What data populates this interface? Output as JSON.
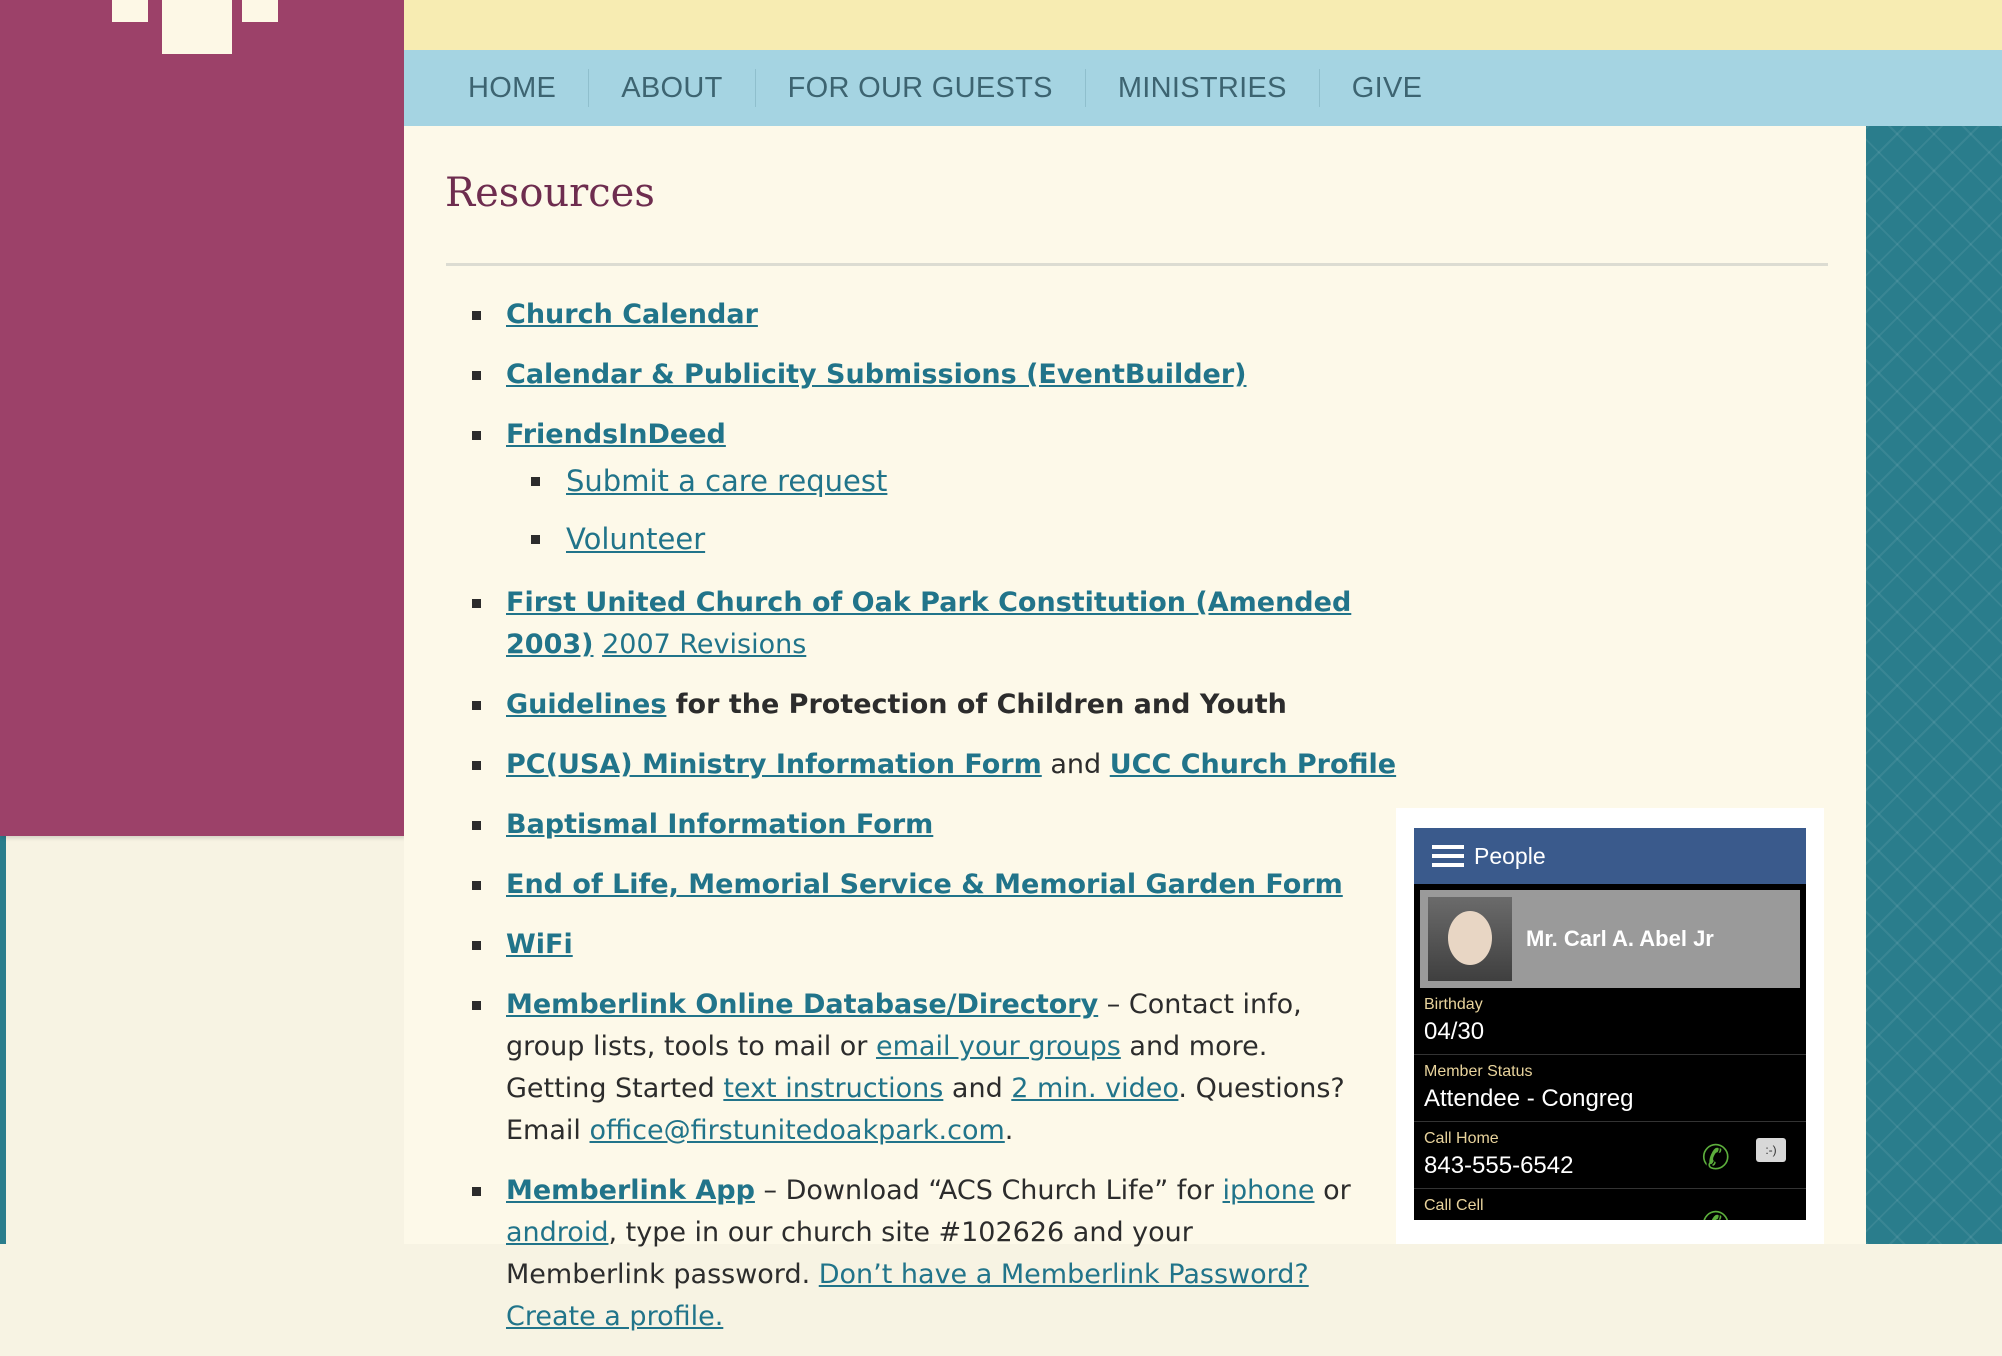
{
  "banner": {
    "tagline": ""
  },
  "nav": [
    "HOME",
    "ABOUT",
    "FOR OUR GUESTS",
    "MINISTRIES",
    "GIVE"
  ],
  "page": {
    "title": "Resources"
  },
  "links": {
    "church_calendar": "Church Calendar",
    "calendar_submissions": "Calendar & Publicity Submissions (EventBuilder)",
    "friends_in_deed": "FriendsInDeed",
    "submit_care_request": "Submit a care request",
    "volunteer": "Volunteer",
    "constitution": "First United Church of Oak Park Constitution (Amended 2003)",
    "revisions_2007": "2007 Revisions",
    "guidelines": "Guidelines",
    "guidelines_rest": " for the Protection of Children and Youth",
    "pcusa_form": "PC(USA) Ministry Information Form",
    "and": " and ",
    "ucc_profile": "UCC Church Profile",
    "baptismal_form": "Baptismal Information Form",
    "end_of_life_form": "End of Life, Memorial Service & Memorial Garden Form",
    "wifi": "WiFi",
    "memberlink_db": "Memberlink Online Database/Directory",
    "memberlink_db_text1": " – Contact info, group lists, tools to mail or ",
    "email_groups": "email your groups",
    "memberlink_db_text2": " and more. Getting Started ",
    "text_instructions": "text instructions",
    "and2": " and ",
    "two_min_video": "2 min. video",
    "memberlink_db_text3": ". Questions? Email ",
    "office_email": "office@firstunitedoakpark.com",
    "period": ".",
    "memberlink_app": "Memberlink App",
    "memberlink_app_text1": " – Download “ACS Church Life” for ",
    "iphone": "iphone",
    "or": " or ",
    "android": "android",
    "memberlink_app_text2": ", type in our church site #102626 and your Memberlink password. ",
    "create_profile": "Don’t have a Memberlink Password? Create a profile."
  },
  "phone": {
    "header": "People",
    "person_name": "Mr. Carl A. Abel Jr",
    "fields": [
      {
        "label": "Birthday",
        "value": "04/30"
      },
      {
        "label": "Member Status",
        "value": "Attendee - Congreg"
      },
      {
        "label": "Call Home",
        "value": "843-555-6542"
      },
      {
        "label": "Call Cell",
        "value": ""
      }
    ],
    "call_icon": "phone-icon",
    "message_icon": "message-icon",
    "message_icon_text": ":-)"
  },
  "colors": {
    "sidebar": "#9c4169",
    "nav": "#a5d4e2",
    "banner": "#f7ecb2",
    "teal": "#2a7d8c",
    "link": "#21748a",
    "title": "#6e2d4f"
  }
}
